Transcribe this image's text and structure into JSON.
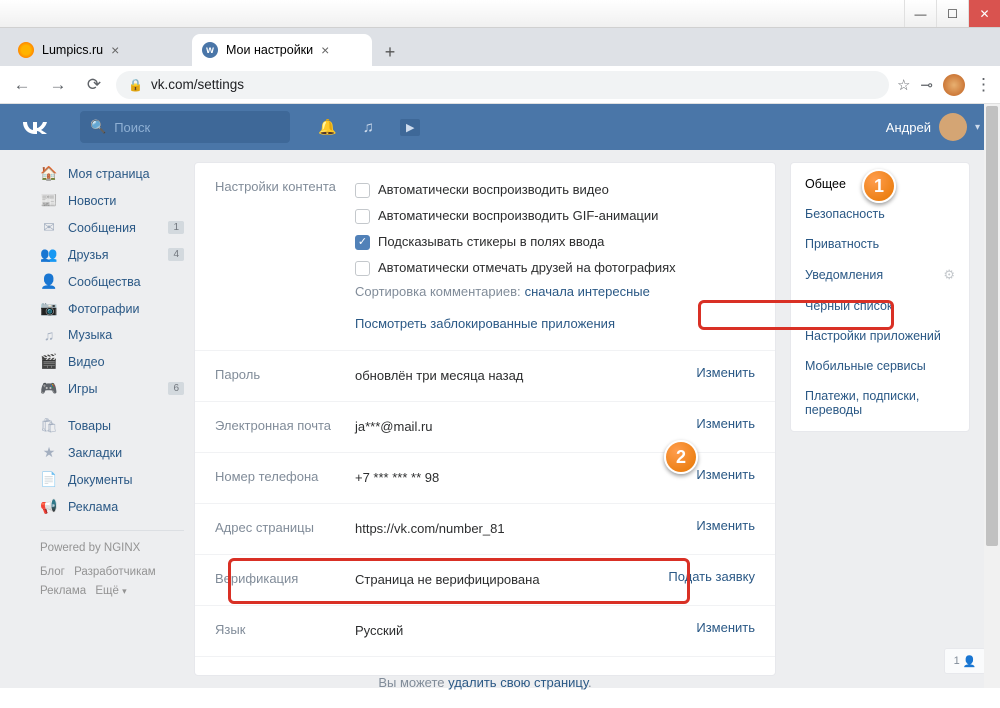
{
  "window": {
    "minimize": "—",
    "maximize": "☐",
    "close": "✕"
  },
  "tabs": {
    "t1": "Lumpics.ru",
    "t2": "Мои настройки",
    "add": "+"
  },
  "addr": {
    "back": "←",
    "fwd": "→",
    "reload": "⟳",
    "lock": "🔒",
    "url": "vk.com/settings",
    "star": "☆",
    "key": "⊸",
    "menu": "⋮"
  },
  "vkHeader": {
    "logo": "VK",
    "searchIcon": "🔍",
    "searchPlaceholder": "Поиск",
    "bell": "🔔",
    "music": "♫",
    "play": "▶",
    "userName": "Андрей",
    "caret": "▾"
  },
  "leftNav": {
    "items": [
      {
        "icon": "🏠",
        "label": "Моя страница"
      },
      {
        "icon": "📰",
        "label": "Новости"
      },
      {
        "icon": "✉",
        "label": "Сообщения",
        "badge": "1"
      },
      {
        "icon": "👥",
        "label": "Друзья",
        "badge": "4"
      },
      {
        "icon": "👤",
        "label": "Сообщества"
      },
      {
        "icon": "📷",
        "label": "Фотографии"
      },
      {
        "icon": "♫",
        "label": "Музыка"
      },
      {
        "icon": "🎬",
        "label": "Видео"
      },
      {
        "icon": "🎮",
        "label": "Игры",
        "badge": "6"
      }
    ],
    "items2": [
      {
        "icon": "🛍",
        "label": "Товары"
      },
      {
        "icon": "★",
        "label": "Закладки"
      },
      {
        "icon": "📄",
        "label": "Документы"
      },
      {
        "icon": "📢",
        "label": "Реклама"
      }
    ],
    "powered": "Powered by NGINX",
    "footer": [
      "Блог",
      "Разработчикам",
      "Реклама",
      "Ещё"
    ]
  },
  "settings": {
    "contentLabel": "Настройки контента",
    "cb1": "Автоматически воспроизводить видео",
    "cb2": "Автоматически воспроизводить GIF-анимации",
    "cb3": "Подсказывать стикеры в полях ввода",
    "cb4": "Автоматически отмечать друзей на фотографиях",
    "sortLabel": "Сортировка комментариев:",
    "sortValue": "сначала интересные",
    "blockedLink": "Посмотреть заблокированные приложения",
    "passwordLabel": "Пароль",
    "passwordValue": "обновлён три месяца назад",
    "emailLabel": "Электронная почта",
    "emailValue": "ja***@mail.ru",
    "phoneLabel": "Номер телефона",
    "phoneValue": "+7 *** *** ** 98",
    "urlLabel": "Адрес страницы",
    "urlValue": "https://vk.com/number_81",
    "verifyLabel": "Верификация",
    "verifyValue": "Страница не верифицирована",
    "verifyAction": "Подать заявку",
    "langLabel": "Язык",
    "langValue": "Русский",
    "changeAction": "Изменить",
    "deletePrefix": "Вы можете ",
    "deleteLink": "удалить свою страницу"
  },
  "rightNav": {
    "items": [
      "Общее",
      "Безопасность",
      "Приватность",
      "Уведомления",
      "Чёрный список",
      "Настройки приложений",
      "Мобильные сервисы",
      "Платежи, подписки, переводы"
    ],
    "gear": "⚙"
  },
  "callouts": {
    "one": "1",
    "two": "2"
  },
  "widget": {
    "count": "1",
    "icon": "👤"
  }
}
